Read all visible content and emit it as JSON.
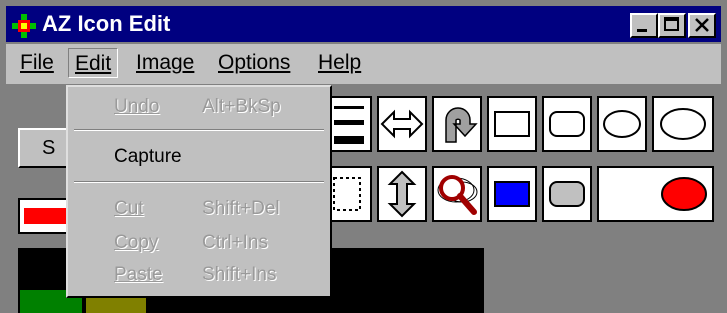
{
  "window": {
    "title": "AZ Icon Edit"
  },
  "titlebar_buttons": {
    "minimize": "minimize-icon",
    "maximize": "maximize-icon",
    "close": "close-icon"
  },
  "menubar": {
    "file": "File",
    "edit": "Edit",
    "image": "Image",
    "options": "Options",
    "help": "Help"
  },
  "edit_menu": {
    "undo": {
      "label": "Undo",
      "shortcut": "Alt+BkSp",
      "enabled": false
    },
    "capture": {
      "label": "Capture",
      "enabled": true
    },
    "cut": {
      "label": "Cut",
      "shortcut": "Shift+Del",
      "enabled": false
    },
    "copy": {
      "label": "Copy",
      "shortcut": "Ctrl+Ins",
      "enabled": false
    },
    "paste": {
      "label": "Paste",
      "shortcut": "Shift+Ins",
      "enabled": false
    }
  },
  "side_button": {
    "label": "S"
  },
  "colors": {
    "titlebar": "#000080",
    "face": "#c0c0c0",
    "red_swatch": "#ff0000",
    "green_swatch": "#008000",
    "olive_swatch": "#808000",
    "blue_fill": "#0000ff",
    "red_fill": "#ff0000"
  },
  "tools": [
    "line-width-icon",
    "horizontal-arrow-icon",
    "rotate-icon",
    "rectangle-icon",
    "rounded-rectangle-icon",
    "ellipse-icon",
    "dotted-selection-icon",
    "vertical-arrow-icon",
    "zoom-icon",
    "filled-rectangle-icon",
    "filled-rounded-rectangle-icon",
    "filled-ellipse-icon"
  ]
}
